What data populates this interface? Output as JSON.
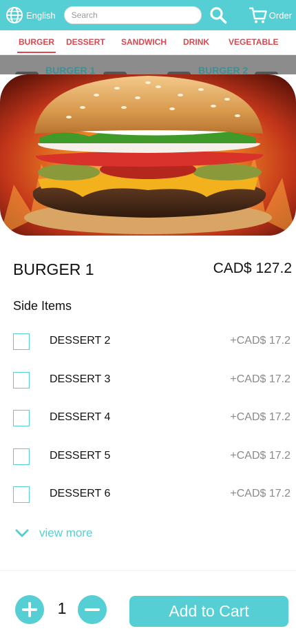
{
  "header": {
    "language_label": "English",
    "search_placeholder": "Search",
    "order_label": "Order",
    "accent_color": "#55cfd3"
  },
  "tabs": [
    {
      "label": "BURGER",
      "active": true
    },
    {
      "label": "DESSERT",
      "active": false
    },
    {
      "label": "SANDWICH",
      "active": false
    },
    {
      "label": "DRINK",
      "active": false
    },
    {
      "label": "VEGETABLE",
      "active": false
    }
  ],
  "background_items": [
    "BURGER 1",
    "BURGER 2"
  ],
  "product": {
    "name": "BURGER 1",
    "price": "CAD$ 127.2",
    "image": "burger-photo"
  },
  "side_items": {
    "title": "Side Items",
    "items": [
      {
        "name": "DESSERT 2",
        "price": "+CAD$ 17.2"
      },
      {
        "name": "DESSERT 3",
        "price": "+CAD$ 17.2"
      },
      {
        "name": "DESSERT 4",
        "price": "+CAD$ 17.2"
      },
      {
        "name": "DESSERT 5",
        "price": "+CAD$ 17.2"
      },
      {
        "name": "DESSERT 6",
        "price": "+CAD$ 17.2"
      }
    ],
    "view_more_label": "view more"
  },
  "cart": {
    "quantity": "1",
    "add_label": "Add to Cart"
  },
  "icons": {
    "language": "globe-icon",
    "search": "search-icon",
    "order": "cart-icon",
    "view_more": "chevron-down-icon",
    "increase": "plus-icon",
    "decrease": "minus-icon"
  }
}
